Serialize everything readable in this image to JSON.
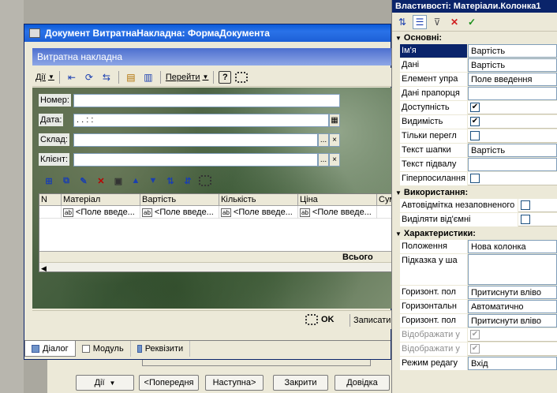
{
  "background": {
    "bottom_buttons": [
      {
        "label": "Дії",
        "caret": "▼"
      },
      {
        "label": "<Попередня"
      },
      {
        "label": "Наступна>"
      },
      {
        "label": "Закрити"
      },
      {
        "label": "Довідка"
      }
    ]
  },
  "window": {
    "title": "Документ ВитратнаНакладна: ФормаДокумента",
    "form_title": "Витратна накладна",
    "toolbar": {
      "actions_label": "Дії",
      "goto_label": "Перейти",
      "help_label": "?"
    },
    "fields": {
      "number_label": "Номер:",
      "number_value": "",
      "date_label": "Дата:",
      "date_value": " .  .    : :",
      "warehouse_label": "Склад:",
      "warehouse_value": "",
      "client_label": "Клієнт:",
      "client_value": "",
      "select_button": "...",
      "clear_button": "×"
    },
    "grid": {
      "columns": [
        "N",
        "Матеріал",
        "Вартість",
        "Кількість",
        "Ціна",
        "Сум"
      ],
      "row_cells": [
        "<Поле введе...",
        "<Поле введе...",
        "<Поле введе...",
        "<Поле введе...",
        ""
      ],
      "cell_icon": "ab",
      "total_label": "Всього"
    },
    "footer": {
      "ok_label": "OK",
      "write_label": "Записати"
    },
    "tabs": [
      {
        "label": "Діалог",
        "active": true
      },
      {
        "label": "Модуль",
        "active": false
      },
      {
        "label": "Реквізити",
        "active": false
      }
    ]
  },
  "properties": {
    "title": "Властивості: Матеріали.Колонка1",
    "sections": {
      "basic": "Основні:",
      "usage": "Використання:",
      "characteristics": "Характеристики:"
    },
    "basic_rows": [
      {
        "name": "Ім'я",
        "value": "Вартість",
        "selected": true
      },
      {
        "name": "Дані",
        "value": "Вартість"
      },
      {
        "name": "Елемент упра",
        "value": "Поле введення"
      },
      {
        "name": "Дані прапорця",
        "value": ""
      },
      {
        "name": "Доступність",
        "check": "✔"
      },
      {
        "name": "Видимість",
        "check": "✔"
      },
      {
        "name": "Тільки перегл",
        "check": ""
      },
      {
        "name": "Текст шапки",
        "value": "Вартість"
      },
      {
        "name": "Текст підвалу",
        "value": ""
      },
      {
        "name": "Гіперпосилання",
        "check": ""
      }
    ],
    "usage_rows": [
      {
        "name": "Автовідмітка незаповненого",
        "check": ""
      },
      {
        "name": "Виділяти від'ємні",
        "check": ""
      }
    ],
    "char_rows": [
      {
        "name": "Положення",
        "value": "Нова колонка"
      },
      {
        "name": "Підказка у ша",
        "value": "",
        "tall": true
      },
      {
        "name": "Горизонт. пол",
        "value": "Притиснути вліво"
      },
      {
        "name": "Горизонтальн",
        "value": "Автоматично"
      },
      {
        "name": "Горизонт. пол",
        "value": "Притиснути вліво"
      },
      {
        "name": "Відображати у",
        "check": "✔",
        "disabled": true
      },
      {
        "name": "Відображати у",
        "check": "✔",
        "disabled": true
      },
      {
        "name": "Режим редагу",
        "value": "Вхід"
      }
    ]
  },
  "colors": {
    "title_bar": "#1c5fd6",
    "form_title": "#8ea7e6",
    "selection": "#0a246a"
  }
}
